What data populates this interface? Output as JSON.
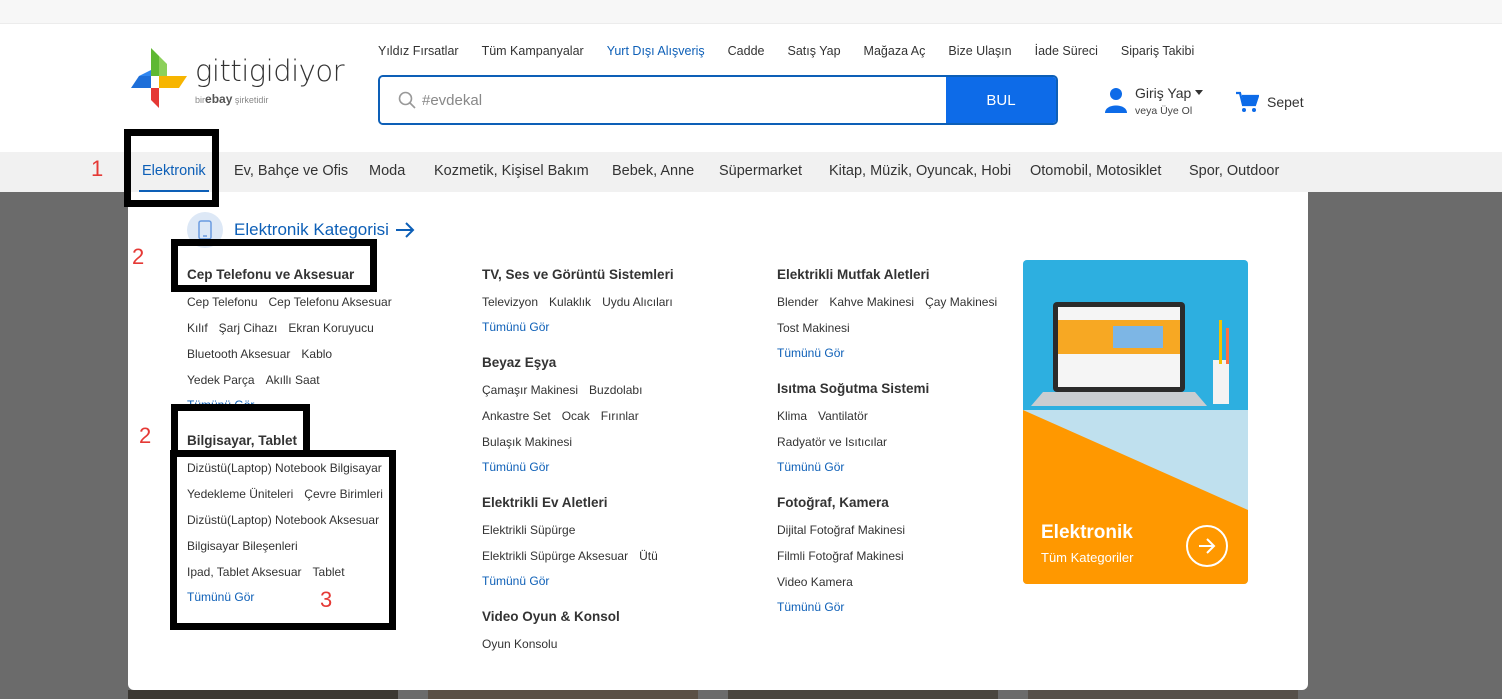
{
  "top_links": [
    "Yıldız Fırsatlar",
    "Tüm Kampanyalar",
    "Yurt Dışı Alışveriş",
    "Cadde",
    "Satış Yap",
    "Mağaza Aç",
    "Bize Ulaşın",
    "İade Süreci",
    "Sipariş Takibi"
  ],
  "logo": {
    "brand": "gittigidiyor",
    "sub_prefix": "bir",
    "sub_brand": "ebay",
    "sub_suffix": "şirketidir"
  },
  "search": {
    "placeholder": "#evdekal",
    "button": "BUL",
    "icon": "search-icon"
  },
  "account": {
    "login": "Giriş Yap",
    "register": "veya Üye Ol",
    "icon": "user-icon"
  },
  "cart": {
    "label": "Sepet",
    "icon": "cart-icon"
  },
  "categories": [
    "Elektronik",
    "Ev, Bahçe ve Ofis",
    "Moda",
    "Kozmetik, Kişisel Bakım",
    "Bebek, Anne",
    "Süpermarket",
    "Kitap, Müzik, Oyuncak, Hobi",
    "Otomobil, Motosiklet",
    "Spor, Outdoor"
  ],
  "active_category": "Elektronik",
  "mega": {
    "heading": "Elektronik Kategorisi",
    "col1": {
      "s1": {
        "title": "Cep Telefonu ve Aksesuar",
        "rows": [
          [
            "Cep Telefonu",
            "Cep Telefonu Aksesuar"
          ],
          [
            "Kılıf",
            "Şarj Cihazı",
            "Ekran Koruyucu"
          ],
          [
            "Bluetooth Aksesuar",
            "Kablo"
          ],
          [
            "Yedek Parça",
            "Akıllı Saat"
          ]
        ],
        "seeall": "Tümünü Gör"
      },
      "s2": {
        "title": "Bilgisayar, Tablet",
        "rows": [
          [
            "Dizüstü(Laptop) Notebook Bilgisayar"
          ],
          [
            "Yedekleme Üniteleri",
            "Çevre Birimleri"
          ],
          [
            "Dizüstü(Laptop) Notebook Aksesuar"
          ],
          [
            "Bilgisayar Bileşenleri"
          ],
          [
            "Ipad, Tablet Aksesuar",
            "Tablet"
          ]
        ],
        "seeall": "Tümünü Gör"
      }
    },
    "col2": {
      "s1": {
        "title": "TV, Ses ve Görüntü Sistemleri",
        "rows": [
          [
            "Televizyon",
            "Kulaklık",
            "Uydu Alıcıları"
          ]
        ],
        "seeall": "Tümünü Gör"
      },
      "s2": {
        "title": "Beyaz Eşya",
        "rows": [
          [
            "Çamaşır Makinesi",
            "Buzdolabı"
          ],
          [
            "Ankastre Set",
            "Ocak",
            "Fırınlar"
          ],
          [
            "Bulaşık Makinesi"
          ]
        ],
        "seeall": "Tümünü Gör"
      },
      "s3": {
        "title": "Elektrikli Ev Aletleri",
        "rows": [
          [
            "Elektrikli Süpürge"
          ],
          [
            "Elektrikli Süpürge Aksesuar",
            "Ütü"
          ]
        ],
        "seeall": "Tümünü Gör"
      },
      "s4": {
        "title": "Video Oyun & Konsol",
        "rows": [
          [
            "Oyun Konsolu"
          ]
        ]
      }
    },
    "col3": {
      "s1": {
        "title": "Elektrikli Mutfak Aletleri",
        "rows": [
          [
            "Blender",
            "Kahve Makinesi",
            "Çay Makinesi"
          ],
          [
            "Tost Makinesi"
          ]
        ],
        "seeall": "Tümünü Gör"
      },
      "s2": {
        "title": "Isıtma Soğutma Sistemi",
        "rows": [
          [
            "Klima",
            "Vantilatör"
          ],
          [
            "Radyatör ve Isıtıcılar"
          ]
        ],
        "seeall": "Tümünü Gör"
      },
      "s3": {
        "title": "Fotoğraf, Kamera",
        "rows": [
          [
            "Dijital Fotoğraf Makinesi"
          ],
          [
            "Filmli Fotoğraf Makinesi"
          ],
          [
            "Video Kamera"
          ]
        ],
        "seeall": "Tümünü Gör"
      }
    },
    "promo": {
      "title": "Elektronik",
      "subtitle": "Tüm Kategoriler"
    }
  },
  "annotations": [
    "1",
    "2",
    "2",
    "3"
  ],
  "colors": {
    "brand_blue": "#0d5fb7",
    "button_blue": "#0d6be8",
    "promo_orange": "#ff9800"
  }
}
